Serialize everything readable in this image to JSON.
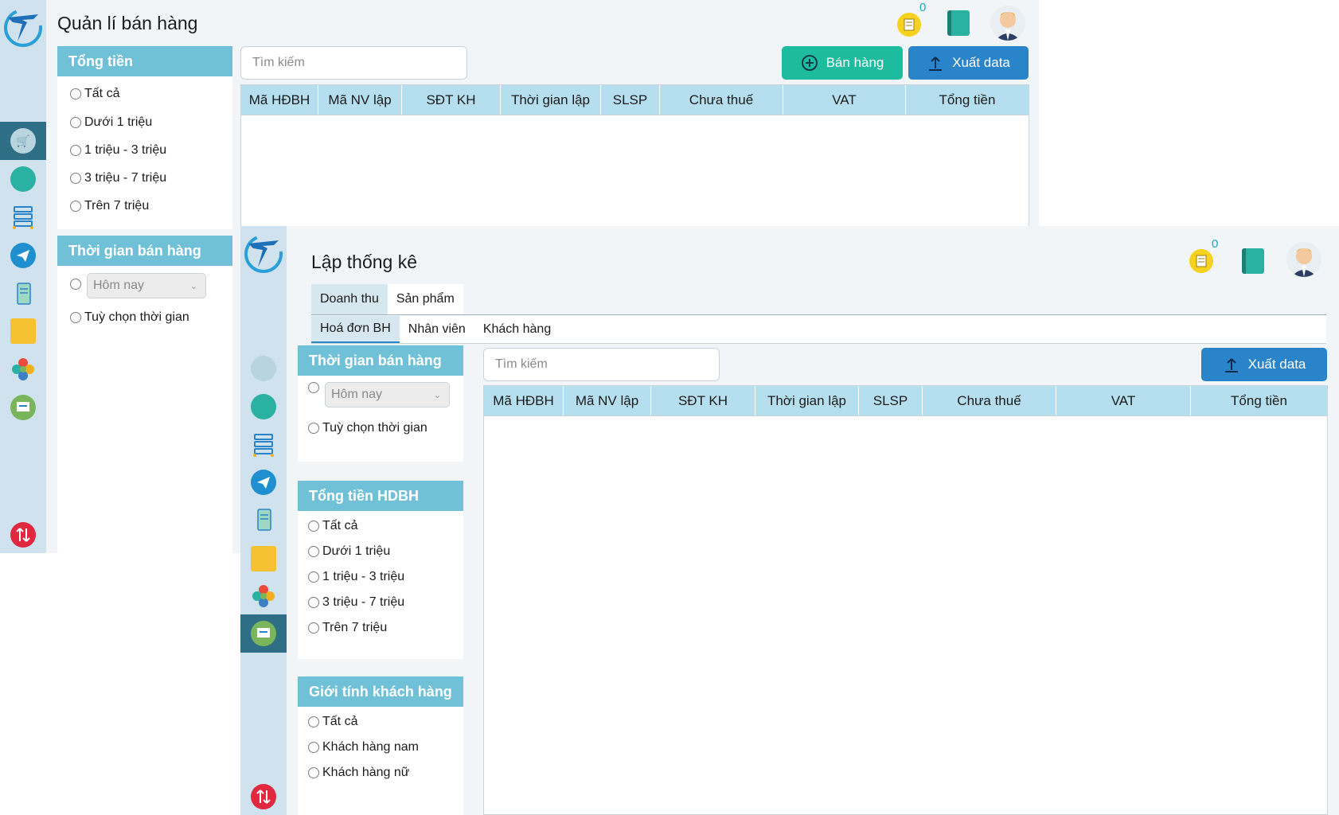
{
  "window1": {
    "title": "Quản lí bán hàng",
    "notification_count": "0",
    "search_placeholder": "Tìm kiếm",
    "sell_button": "Bán hàng",
    "export_button": "Xuất data",
    "columns": [
      "Mã HĐBH",
      "Mã NV lập",
      "SĐT KH",
      "Thời gian lập",
      "SLSP",
      "Chưa thuế",
      "VAT",
      "Tổng tiền"
    ],
    "filters": {
      "total": {
        "heading": "Tổng tiền",
        "options": [
          "Tất cả",
          "Dưới 1 triệu",
          "1 triệu - 3 triệu",
          "3 triệu - 7 triệu",
          "Trên 7 triệu"
        ]
      },
      "time": {
        "heading": "Thời gian bán hàng",
        "select_value": "Hôm nay",
        "custom_option": "Tuỳ chọn thời gian"
      }
    }
  },
  "window2": {
    "title": "Lập thống kê",
    "notification_count": "0",
    "main_tabs": [
      "Doanh thu",
      "Sản phẩm"
    ],
    "sub_tabs": [
      "Hoá đơn BH",
      "Nhân viên",
      "Khách hàng"
    ],
    "search_placeholder": "Tìm kiếm",
    "export_button": "Xuất data",
    "columns": [
      "Mã HĐBH",
      "Mã NV lập",
      "SĐT KH",
      "Thời gian lập",
      "SLSP",
      "Chưa thuế",
      "VAT",
      "Tổng tiền"
    ],
    "filters": {
      "time": {
        "heading": "Thời gian bán hàng",
        "select_value": "Hôm nay",
        "custom_option": "Tuỳ chọn thời gian"
      },
      "total": {
        "heading": "Tổng tiền HDBH",
        "options": [
          "Tất cả",
          "Dưới 1 triệu",
          "1 triệu - 3 triệu",
          "3 triệu - 7 triệu",
          "Trên 7 triệu"
        ]
      },
      "gender": {
        "heading": "Giới tính khách hàng",
        "options": [
          "Tất cả",
          "Khách hàng nam",
          "Khách hàng nữ"
        ]
      }
    }
  },
  "icons": {
    "logo": "brand-logo-icon",
    "cart": "cart-icon",
    "report": "report-icon",
    "list": "list-icon",
    "send": "send-icon",
    "receipt": "receipt-icon",
    "note": "note-icon",
    "flower": "category-icon",
    "chart": "chart-board-icon",
    "swap": "swap-icon",
    "notification": "notification-icon",
    "contacts": "contacts-icon",
    "avatar": "avatar-icon"
  },
  "colors": {
    "rail": "#cfe2ee",
    "rail_active": "#2f6f86",
    "filter_header": "#70c1d8",
    "table_header": "#b5dfee",
    "sell_button": "#1ebc9e",
    "export_button": "#2a84c9"
  }
}
